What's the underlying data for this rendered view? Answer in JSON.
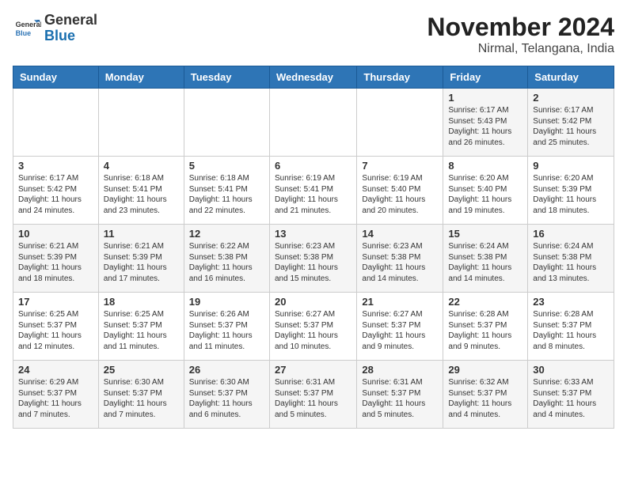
{
  "header": {
    "logo_general": "General",
    "logo_blue": "Blue",
    "month_title": "November 2024",
    "location": "Nirmal, Telangana, India"
  },
  "weekdays": [
    "Sunday",
    "Monday",
    "Tuesday",
    "Wednesday",
    "Thursday",
    "Friday",
    "Saturday"
  ],
  "weeks": [
    [
      {
        "day": "",
        "info": ""
      },
      {
        "day": "",
        "info": ""
      },
      {
        "day": "",
        "info": ""
      },
      {
        "day": "",
        "info": ""
      },
      {
        "day": "",
        "info": ""
      },
      {
        "day": "1",
        "info": "Sunrise: 6:17 AM\nSunset: 5:43 PM\nDaylight: 11 hours and 26 minutes."
      },
      {
        "day": "2",
        "info": "Sunrise: 6:17 AM\nSunset: 5:42 PM\nDaylight: 11 hours and 25 minutes."
      }
    ],
    [
      {
        "day": "3",
        "info": "Sunrise: 6:17 AM\nSunset: 5:42 PM\nDaylight: 11 hours and 24 minutes."
      },
      {
        "day": "4",
        "info": "Sunrise: 6:18 AM\nSunset: 5:41 PM\nDaylight: 11 hours and 23 minutes."
      },
      {
        "day": "5",
        "info": "Sunrise: 6:18 AM\nSunset: 5:41 PM\nDaylight: 11 hours and 22 minutes."
      },
      {
        "day": "6",
        "info": "Sunrise: 6:19 AM\nSunset: 5:41 PM\nDaylight: 11 hours and 21 minutes."
      },
      {
        "day": "7",
        "info": "Sunrise: 6:19 AM\nSunset: 5:40 PM\nDaylight: 11 hours and 20 minutes."
      },
      {
        "day": "8",
        "info": "Sunrise: 6:20 AM\nSunset: 5:40 PM\nDaylight: 11 hours and 19 minutes."
      },
      {
        "day": "9",
        "info": "Sunrise: 6:20 AM\nSunset: 5:39 PM\nDaylight: 11 hours and 18 minutes."
      }
    ],
    [
      {
        "day": "10",
        "info": "Sunrise: 6:21 AM\nSunset: 5:39 PM\nDaylight: 11 hours and 18 minutes."
      },
      {
        "day": "11",
        "info": "Sunrise: 6:21 AM\nSunset: 5:39 PM\nDaylight: 11 hours and 17 minutes."
      },
      {
        "day": "12",
        "info": "Sunrise: 6:22 AM\nSunset: 5:38 PM\nDaylight: 11 hours and 16 minutes."
      },
      {
        "day": "13",
        "info": "Sunrise: 6:23 AM\nSunset: 5:38 PM\nDaylight: 11 hours and 15 minutes."
      },
      {
        "day": "14",
        "info": "Sunrise: 6:23 AM\nSunset: 5:38 PM\nDaylight: 11 hours and 14 minutes."
      },
      {
        "day": "15",
        "info": "Sunrise: 6:24 AM\nSunset: 5:38 PM\nDaylight: 11 hours and 14 minutes."
      },
      {
        "day": "16",
        "info": "Sunrise: 6:24 AM\nSunset: 5:38 PM\nDaylight: 11 hours and 13 minutes."
      }
    ],
    [
      {
        "day": "17",
        "info": "Sunrise: 6:25 AM\nSunset: 5:37 PM\nDaylight: 11 hours and 12 minutes."
      },
      {
        "day": "18",
        "info": "Sunrise: 6:25 AM\nSunset: 5:37 PM\nDaylight: 11 hours and 11 minutes."
      },
      {
        "day": "19",
        "info": "Sunrise: 6:26 AM\nSunset: 5:37 PM\nDaylight: 11 hours and 11 minutes."
      },
      {
        "day": "20",
        "info": "Sunrise: 6:27 AM\nSunset: 5:37 PM\nDaylight: 11 hours and 10 minutes."
      },
      {
        "day": "21",
        "info": "Sunrise: 6:27 AM\nSunset: 5:37 PM\nDaylight: 11 hours and 9 minutes."
      },
      {
        "day": "22",
        "info": "Sunrise: 6:28 AM\nSunset: 5:37 PM\nDaylight: 11 hours and 9 minutes."
      },
      {
        "day": "23",
        "info": "Sunrise: 6:28 AM\nSunset: 5:37 PM\nDaylight: 11 hours and 8 minutes."
      }
    ],
    [
      {
        "day": "24",
        "info": "Sunrise: 6:29 AM\nSunset: 5:37 PM\nDaylight: 11 hours and 7 minutes."
      },
      {
        "day": "25",
        "info": "Sunrise: 6:30 AM\nSunset: 5:37 PM\nDaylight: 11 hours and 7 minutes."
      },
      {
        "day": "26",
        "info": "Sunrise: 6:30 AM\nSunset: 5:37 PM\nDaylight: 11 hours and 6 minutes."
      },
      {
        "day": "27",
        "info": "Sunrise: 6:31 AM\nSunset: 5:37 PM\nDaylight: 11 hours and 5 minutes."
      },
      {
        "day": "28",
        "info": "Sunrise: 6:31 AM\nSunset: 5:37 PM\nDaylight: 11 hours and 5 minutes."
      },
      {
        "day": "29",
        "info": "Sunrise: 6:32 AM\nSunset: 5:37 PM\nDaylight: 11 hours and 4 minutes."
      },
      {
        "day": "30",
        "info": "Sunrise: 6:33 AM\nSunset: 5:37 PM\nDaylight: 11 hours and 4 minutes."
      }
    ]
  ]
}
